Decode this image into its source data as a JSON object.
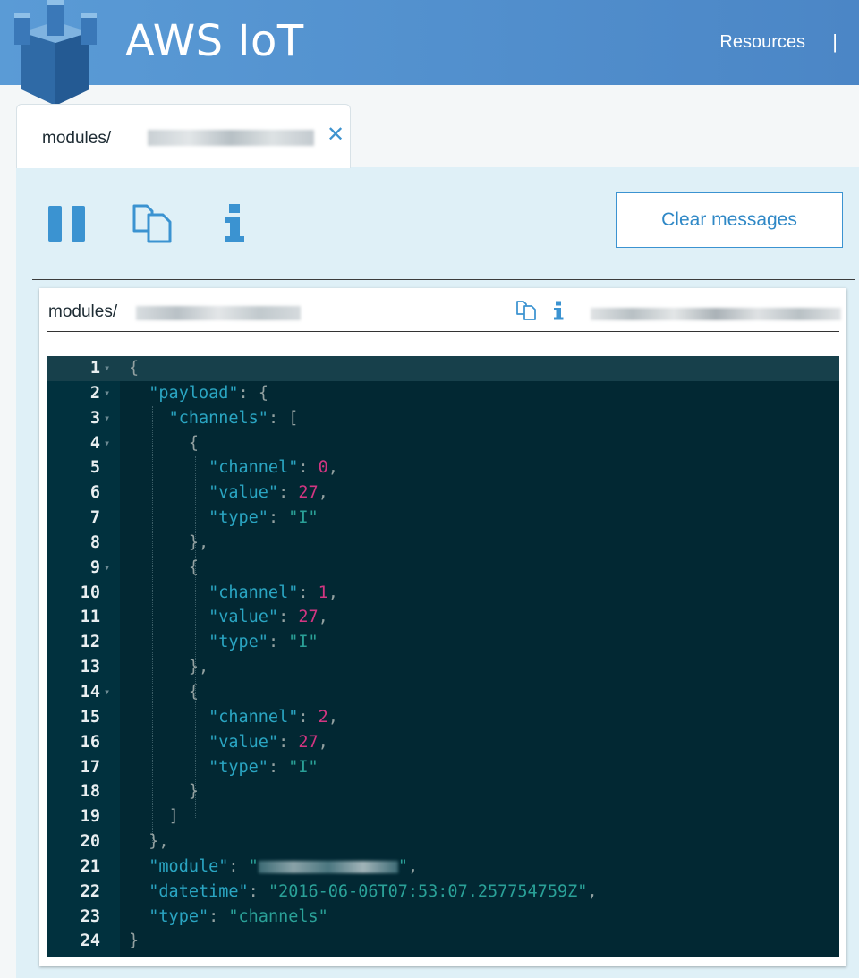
{
  "header": {
    "brand": "AWS IoT",
    "nav_resources": "Resources",
    "nav_separator": "|"
  },
  "tab": {
    "label": "modules/"
  },
  "toolbar": {
    "clear_label": "Clear messages"
  },
  "message": {
    "topic": "modules/"
  },
  "editor": {
    "lines": [
      {
        "n": "1",
        "fold": "▾"
      },
      {
        "n": "2",
        "fold": "▾"
      },
      {
        "n": "3",
        "fold": "▾"
      },
      {
        "n": "4",
        "fold": "▾"
      },
      {
        "n": "5",
        "fold": ""
      },
      {
        "n": "6",
        "fold": ""
      },
      {
        "n": "7",
        "fold": ""
      },
      {
        "n": "8",
        "fold": ""
      },
      {
        "n": "9",
        "fold": "▾"
      },
      {
        "n": "10",
        "fold": ""
      },
      {
        "n": "11",
        "fold": ""
      },
      {
        "n": "12",
        "fold": ""
      },
      {
        "n": "13",
        "fold": ""
      },
      {
        "n": "14",
        "fold": "▾"
      },
      {
        "n": "15",
        "fold": ""
      },
      {
        "n": "16",
        "fold": ""
      },
      {
        "n": "17",
        "fold": ""
      },
      {
        "n": "18",
        "fold": ""
      },
      {
        "n": "19",
        "fold": ""
      },
      {
        "n": "20",
        "fold": ""
      },
      {
        "n": "21",
        "fold": ""
      },
      {
        "n": "22",
        "fold": ""
      },
      {
        "n": "23",
        "fold": ""
      },
      {
        "n": "24",
        "fold": ""
      }
    ],
    "tokens": {
      "brace_open": "{",
      "brace_close": "}",
      "brace_close_comma": "},",
      "bracket_open": "[",
      "bracket_close": "]",
      "colon": ": ",
      "comma": ",",
      "quote": "\"",
      "key_payload": "\"payload\"",
      "key_channels": "\"channels\"",
      "key_channel": "\"channel\"",
      "key_value": "\"value\"",
      "key_type": "\"type\"",
      "key_module": "\"module\"",
      "key_datetime": "\"datetime\"",
      "num_0": "0",
      "num_1": "1",
      "num_2": "2",
      "num_27": "27",
      "str_I": "\"I\"",
      "str_datetime": "\"2016-06-06T07:53:07.257754759Z\"",
      "str_channels": "\"channels\""
    }
  },
  "colors": {
    "header": "#4b86c6",
    "accent": "#3b93d1",
    "panel": "#dff0f7",
    "editor_bg": "#022833"
  }
}
